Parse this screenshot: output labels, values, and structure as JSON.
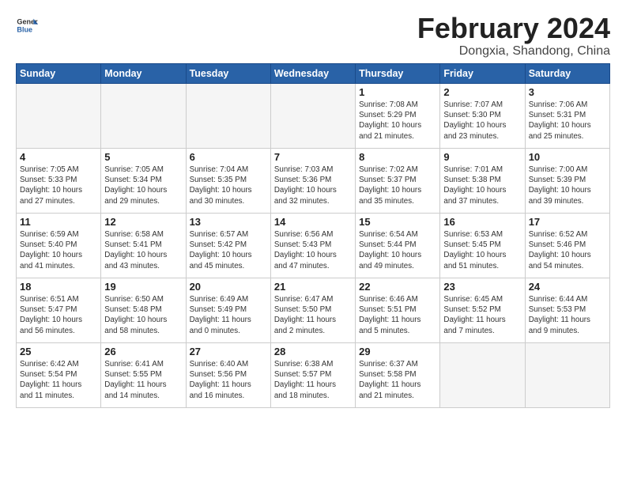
{
  "logo": {
    "general": "General",
    "blue": "Blue"
  },
  "title": "February 2024",
  "subtitle": "Dongxia, Shandong, China",
  "weekdays": [
    "Sunday",
    "Monday",
    "Tuesday",
    "Wednesday",
    "Thursday",
    "Friday",
    "Saturday"
  ],
  "weeks": [
    [
      {
        "day": "",
        "info": ""
      },
      {
        "day": "",
        "info": ""
      },
      {
        "day": "",
        "info": ""
      },
      {
        "day": "",
        "info": ""
      },
      {
        "day": "1",
        "info": "Sunrise: 7:08 AM\nSunset: 5:29 PM\nDaylight: 10 hours\nand 21 minutes."
      },
      {
        "day": "2",
        "info": "Sunrise: 7:07 AM\nSunset: 5:30 PM\nDaylight: 10 hours\nand 23 minutes."
      },
      {
        "day": "3",
        "info": "Sunrise: 7:06 AM\nSunset: 5:31 PM\nDaylight: 10 hours\nand 25 minutes."
      }
    ],
    [
      {
        "day": "4",
        "info": "Sunrise: 7:05 AM\nSunset: 5:33 PM\nDaylight: 10 hours\nand 27 minutes."
      },
      {
        "day": "5",
        "info": "Sunrise: 7:05 AM\nSunset: 5:34 PM\nDaylight: 10 hours\nand 29 minutes."
      },
      {
        "day": "6",
        "info": "Sunrise: 7:04 AM\nSunset: 5:35 PM\nDaylight: 10 hours\nand 30 minutes."
      },
      {
        "day": "7",
        "info": "Sunrise: 7:03 AM\nSunset: 5:36 PM\nDaylight: 10 hours\nand 32 minutes."
      },
      {
        "day": "8",
        "info": "Sunrise: 7:02 AM\nSunset: 5:37 PM\nDaylight: 10 hours\nand 35 minutes."
      },
      {
        "day": "9",
        "info": "Sunrise: 7:01 AM\nSunset: 5:38 PM\nDaylight: 10 hours\nand 37 minutes."
      },
      {
        "day": "10",
        "info": "Sunrise: 7:00 AM\nSunset: 5:39 PM\nDaylight: 10 hours\nand 39 minutes."
      }
    ],
    [
      {
        "day": "11",
        "info": "Sunrise: 6:59 AM\nSunset: 5:40 PM\nDaylight: 10 hours\nand 41 minutes."
      },
      {
        "day": "12",
        "info": "Sunrise: 6:58 AM\nSunset: 5:41 PM\nDaylight: 10 hours\nand 43 minutes."
      },
      {
        "day": "13",
        "info": "Sunrise: 6:57 AM\nSunset: 5:42 PM\nDaylight: 10 hours\nand 45 minutes."
      },
      {
        "day": "14",
        "info": "Sunrise: 6:56 AM\nSunset: 5:43 PM\nDaylight: 10 hours\nand 47 minutes."
      },
      {
        "day": "15",
        "info": "Sunrise: 6:54 AM\nSunset: 5:44 PM\nDaylight: 10 hours\nand 49 minutes."
      },
      {
        "day": "16",
        "info": "Sunrise: 6:53 AM\nSunset: 5:45 PM\nDaylight: 10 hours\nand 51 minutes."
      },
      {
        "day": "17",
        "info": "Sunrise: 6:52 AM\nSunset: 5:46 PM\nDaylight: 10 hours\nand 54 minutes."
      }
    ],
    [
      {
        "day": "18",
        "info": "Sunrise: 6:51 AM\nSunset: 5:47 PM\nDaylight: 10 hours\nand 56 minutes."
      },
      {
        "day": "19",
        "info": "Sunrise: 6:50 AM\nSunset: 5:48 PM\nDaylight: 10 hours\nand 58 minutes."
      },
      {
        "day": "20",
        "info": "Sunrise: 6:49 AM\nSunset: 5:49 PM\nDaylight: 11 hours\nand 0 minutes."
      },
      {
        "day": "21",
        "info": "Sunrise: 6:47 AM\nSunset: 5:50 PM\nDaylight: 11 hours\nand 2 minutes."
      },
      {
        "day": "22",
        "info": "Sunrise: 6:46 AM\nSunset: 5:51 PM\nDaylight: 11 hours\nand 5 minutes."
      },
      {
        "day": "23",
        "info": "Sunrise: 6:45 AM\nSunset: 5:52 PM\nDaylight: 11 hours\nand 7 minutes."
      },
      {
        "day": "24",
        "info": "Sunrise: 6:44 AM\nSunset: 5:53 PM\nDaylight: 11 hours\nand 9 minutes."
      }
    ],
    [
      {
        "day": "25",
        "info": "Sunrise: 6:42 AM\nSunset: 5:54 PM\nDaylight: 11 hours\nand 11 minutes."
      },
      {
        "day": "26",
        "info": "Sunrise: 6:41 AM\nSunset: 5:55 PM\nDaylight: 11 hours\nand 14 minutes."
      },
      {
        "day": "27",
        "info": "Sunrise: 6:40 AM\nSunset: 5:56 PM\nDaylight: 11 hours\nand 16 minutes."
      },
      {
        "day": "28",
        "info": "Sunrise: 6:38 AM\nSunset: 5:57 PM\nDaylight: 11 hours\nand 18 minutes."
      },
      {
        "day": "29",
        "info": "Sunrise: 6:37 AM\nSunset: 5:58 PM\nDaylight: 11 hours\nand 21 minutes."
      },
      {
        "day": "",
        "info": ""
      },
      {
        "day": "",
        "info": ""
      }
    ]
  ]
}
